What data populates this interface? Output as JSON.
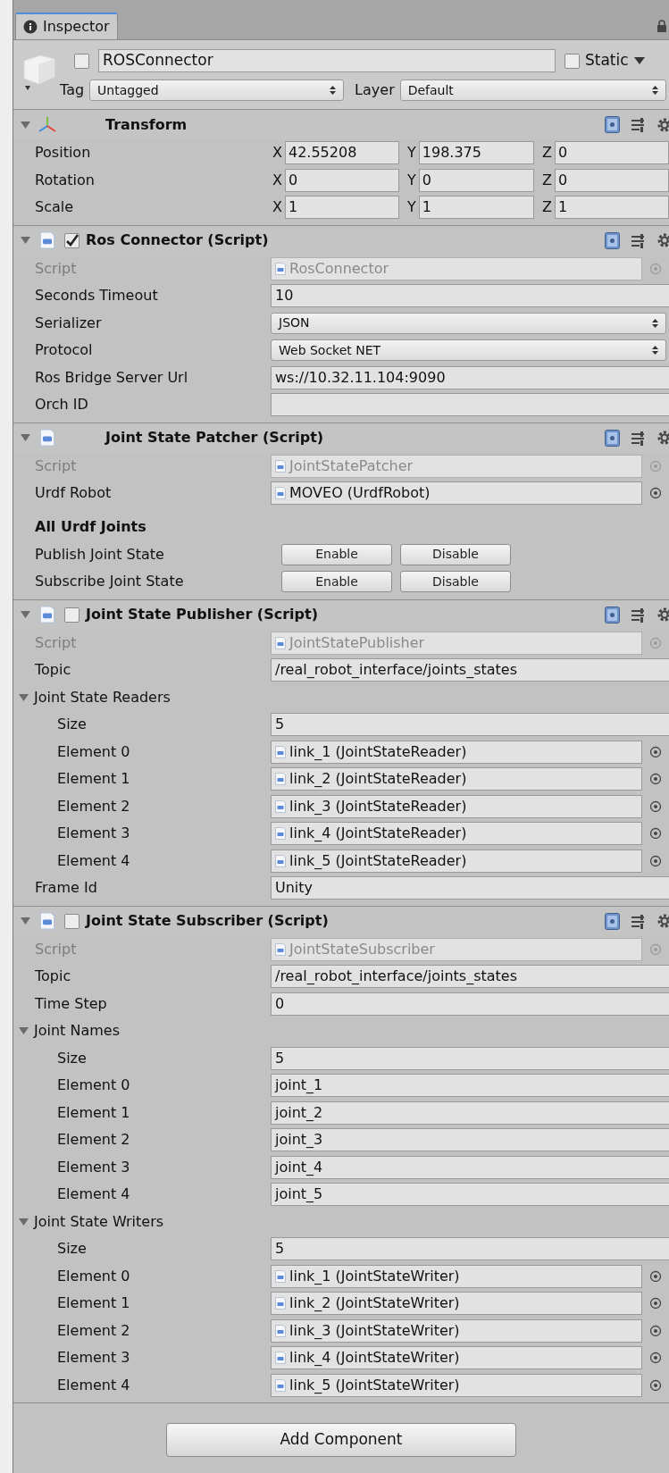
{
  "tabs": [
    {
      "label": "Inspector",
      "selected": true
    }
  ],
  "object": {
    "active": false,
    "name": "ROSConnector",
    "static": false,
    "static_label": "Static",
    "tag_label": "Tag",
    "tag": "Untagged",
    "layer_label": "Layer",
    "layer": "Default"
  },
  "components": [
    {
      "title": "Transform",
      "kind": "transform",
      "expanded": true,
      "rows": [
        {
          "kind": "vector",
          "label": "Position",
          "axes": [
            {
              "axis": "X",
              "value": "42.55208"
            },
            {
              "axis": "Y",
              "value": "198.375"
            },
            {
              "axis": "Z",
              "value": "0"
            }
          ]
        },
        {
          "kind": "vector",
          "label": "Rotation",
          "axes": [
            {
              "axis": "X",
              "value": "0"
            },
            {
              "axis": "Y",
              "value": "0"
            },
            {
              "axis": "Z",
              "value": "0"
            }
          ]
        },
        {
          "kind": "vector",
          "label": "Scale",
          "axes": [
            {
              "axis": "X",
              "value": "1"
            },
            {
              "axis": "Y",
              "value": "1"
            },
            {
              "axis": "Z",
              "value": "1"
            }
          ]
        }
      ]
    },
    {
      "title": "Ros Connector (Script)",
      "kind": "script",
      "enabled": true,
      "expanded": true,
      "rows": [
        {
          "kind": "script",
          "label": "Script",
          "value": "RosConnector"
        },
        {
          "kind": "text",
          "label": "Seconds Timeout",
          "value": "10"
        },
        {
          "kind": "dropdown",
          "label": "Serializer",
          "value": "JSON"
        },
        {
          "kind": "dropdown",
          "label": "Protocol",
          "value": "Web Socket NET"
        },
        {
          "kind": "text",
          "label": "Ros Bridge Server Url",
          "value": "ws://10.32.11.104:9090"
        },
        {
          "kind": "text",
          "label": "Orch ID"
        }
      ]
    },
    {
      "title": "Joint State Patcher (Script)",
      "kind": "script",
      "expanded": true,
      "rows": [
        {
          "kind": "script",
          "label": "Script",
          "value": "JointStatePatcher"
        },
        {
          "kind": "object",
          "label": "Urdf Robot",
          "value": "MOVEO (UrdfRobot)"
        },
        {
          "kind": "heading",
          "label": "All Urdf Joints"
        },
        {
          "kind": "buttons",
          "label": "Publish Joint State",
          "buttons": [
            "Enable",
            "Disable"
          ]
        },
        {
          "kind": "buttons",
          "label": "Subscribe Joint State",
          "buttons": [
            "Enable",
            "Disable"
          ]
        }
      ]
    },
    {
      "title": "Joint State Publisher (Script)",
      "kind": "script",
      "enabled": false,
      "expanded": true,
      "rows": [
        {
          "kind": "script",
          "label": "Script",
          "value": "JointStatePublisher"
        },
        {
          "kind": "text",
          "label": "Topic",
          "value": "/real_robot_interface/joints_states"
        },
        {
          "kind": "foldout",
          "label": "Joint State Readers",
          "expanded": true,
          "children": [
            {
              "kind": "text",
              "label": "Size",
              "value": "5"
            },
            {
              "kind": "object",
              "label": "Element 0",
              "value": "link_1 (JointStateReader)"
            },
            {
              "kind": "object",
              "label": "Element 1",
              "value": "link_2 (JointStateReader)"
            },
            {
              "kind": "object",
              "label": "Element 2",
              "value": "link_3 (JointStateReader)"
            },
            {
              "kind": "object",
              "label": "Element 3",
              "value": "link_4 (JointStateReader)"
            },
            {
              "kind": "object",
              "label": "Element 4",
              "value": "link_5 (JointStateReader)"
            }
          ]
        },
        {
          "kind": "text",
          "label": "Frame Id",
          "value": "Unity"
        }
      ]
    },
    {
      "title": "Joint State Subscriber (Script)",
      "kind": "script",
      "enabled": false,
      "expanded": true,
      "rows": [
        {
          "kind": "script",
          "label": "Script",
          "value": "JointStateSubscriber"
        },
        {
          "kind": "text",
          "label": "Topic",
          "value": "/real_robot_interface/joints_states"
        },
        {
          "kind": "text",
          "label": "Time Step",
          "value": "0"
        },
        {
          "kind": "foldout",
          "label": "Joint Names",
          "expanded": true,
          "children": [
            {
              "kind": "text",
              "label": "Size",
              "value": "5"
            },
            {
              "kind": "text",
              "label": "Element 0",
              "value": "joint_1"
            },
            {
              "kind": "text",
              "label": "Element 1",
              "value": "joint_2"
            },
            {
              "kind": "text",
              "label": "Element 2",
              "value": "joint_3"
            },
            {
              "kind": "text",
              "label": "Element 3",
              "value": "joint_4"
            },
            {
              "kind": "text",
              "label": "Element 4",
              "value": "joint_5"
            }
          ]
        },
        {
          "kind": "foldout",
          "label": "Joint State Writers",
          "expanded": true,
          "children": [
            {
              "kind": "text",
              "label": "Size",
              "value": "5"
            },
            {
              "kind": "object",
              "label": "Element 0",
              "value": "link_1 (JointStateWriter)"
            },
            {
              "kind": "object",
              "label": "Element 1",
              "value": "link_2 (JointStateWriter)"
            },
            {
              "kind": "object",
              "label": "Element 2",
              "value": "link_3 (JointStateWriter)"
            },
            {
              "kind": "object",
              "label": "Element 3",
              "value": "link_4 (JointStateWriter)"
            },
            {
              "kind": "object",
              "label": "Element 4",
              "value": "link_5 (JointStateWriter)"
            }
          ]
        }
      ]
    }
  ],
  "add_button": "Add Component"
}
